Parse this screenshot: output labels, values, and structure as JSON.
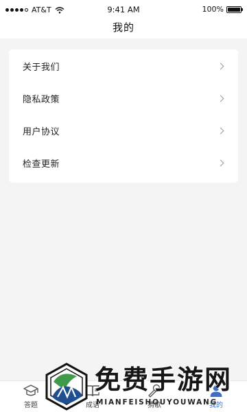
{
  "status_bar": {
    "carrier": "AT&T",
    "time": "9:41 AM",
    "battery": "100%",
    "battery_level": 1.0,
    "signal_dots": 5,
    "signal_filled": 4
  },
  "header": {
    "title": "我的"
  },
  "menu": {
    "items": [
      {
        "label": "关于我们",
        "icon": "chevron-right-icon"
      },
      {
        "label": "隐私政策",
        "icon": "chevron-right-icon"
      },
      {
        "label": "用户协议",
        "icon": "chevron-right-icon"
      },
      {
        "label": "检查更新",
        "icon": "chevron-right-icon"
      }
    ]
  },
  "tab_bar": {
    "tabs": [
      {
        "label": "答题",
        "icon": "graduation-cap-icon",
        "active": false
      },
      {
        "label": "成语",
        "icon": "book-icon",
        "active": false
      },
      {
        "label": "猜歌",
        "icon": "microphone-icon",
        "active": false
      },
      {
        "label": "我的",
        "icon": "user-icon",
        "active": true
      }
    ],
    "active_color": "#3d6fc4"
  },
  "watermark": {
    "title": "免费手游网",
    "subtitle": "MIANFEISHOUYOUWANG"
  }
}
